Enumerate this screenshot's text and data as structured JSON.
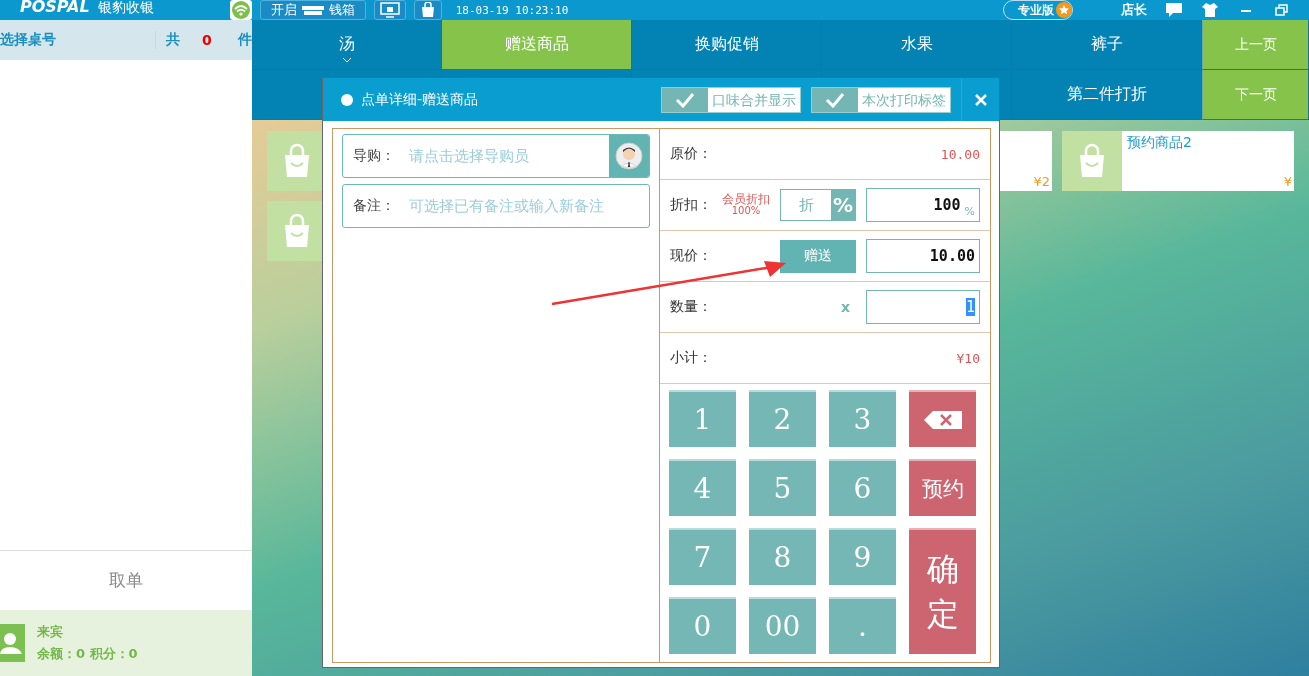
{
  "top_bar": {
    "logo": "POSPAL",
    "brand": "银豹收银",
    "cash_drawer_button": {
      "left": "开启",
      "right": "钱箱"
    },
    "time": "18-03-19 10:23:10",
    "edition": "专业版",
    "user": "店长"
  },
  "left_panel": {
    "table_prompt": "选择桌号",
    "count_prefix": "共",
    "count": "0",
    "count_suffix": "件",
    "pickup_button": "取单",
    "member": {
      "name": "来宾",
      "balance": "余额：0 积分：0"
    }
  },
  "category_tabs": [
    {
      "label": "汤",
      "selected": false,
      "expandable": true
    },
    {
      "label": "赠送商品",
      "selected": true,
      "expandable": false
    },
    {
      "label": "换购促销",
      "selected": false,
      "expandable": false
    },
    {
      "label": "水果",
      "selected": false,
      "expandable": false
    },
    {
      "label": "裤子",
      "selected": false,
      "expandable": false
    }
  ],
  "category_tabs_row2": [
    {
      "label": "第二件打折",
      "selected": false
    }
  ],
  "page_buttons": [
    "上一页",
    "下一页"
  ],
  "products": [
    {
      "price": "¥2"
    },
    {
      "name": "预约商品2",
      "price": "¥"
    }
  ],
  "dialog": {
    "title": "点单详细-赠送商品",
    "toggles": [
      {
        "label": "口味合并显示",
        "checked": true
      },
      {
        "label": "本次打印标签",
        "checked": true
      }
    ],
    "guide": {
      "label": "导购：",
      "placeholder": "请点击选择导购员"
    },
    "note": {
      "label": "备注：",
      "placeholder": "可选择已有备注或输入新备注"
    },
    "original_price": {
      "label": "原价：",
      "value": "10.00"
    },
    "discount": {
      "label": "折扣：",
      "member_discount": "会员折扣",
      "member_rate": "100%",
      "mode_button": "折",
      "percent_button": "%",
      "value": "100",
      "unit": "%"
    },
    "current_price": {
      "label": "现价：",
      "gift_button": "赠送",
      "value": "10.00"
    },
    "quantity": {
      "label": "数量：",
      "times": "x",
      "value": "1"
    },
    "subtotal": {
      "label": "小计：",
      "value": "¥10"
    },
    "keypad": [
      {
        "kind": "digit",
        "label": "1"
      },
      {
        "kind": "digit",
        "label": "2"
      },
      {
        "kind": "digit",
        "label": "3"
      },
      {
        "kind": "backspace"
      },
      {
        "kind": "digit",
        "label": "4"
      },
      {
        "kind": "digit",
        "label": "5"
      },
      {
        "kind": "digit",
        "label": "6"
      },
      {
        "kind": "action",
        "label": "预约"
      },
      {
        "kind": "digit",
        "label": "7"
      },
      {
        "kind": "digit",
        "label": "8"
      },
      {
        "kind": "digit",
        "label": "9"
      },
      {
        "kind": "digit",
        "label": "0"
      },
      {
        "kind": "digit",
        "label": "00"
      },
      {
        "kind": "digit",
        "label": "."
      },
      {
        "kind": "confirm",
        "label": "确定"
      }
    ]
  }
}
